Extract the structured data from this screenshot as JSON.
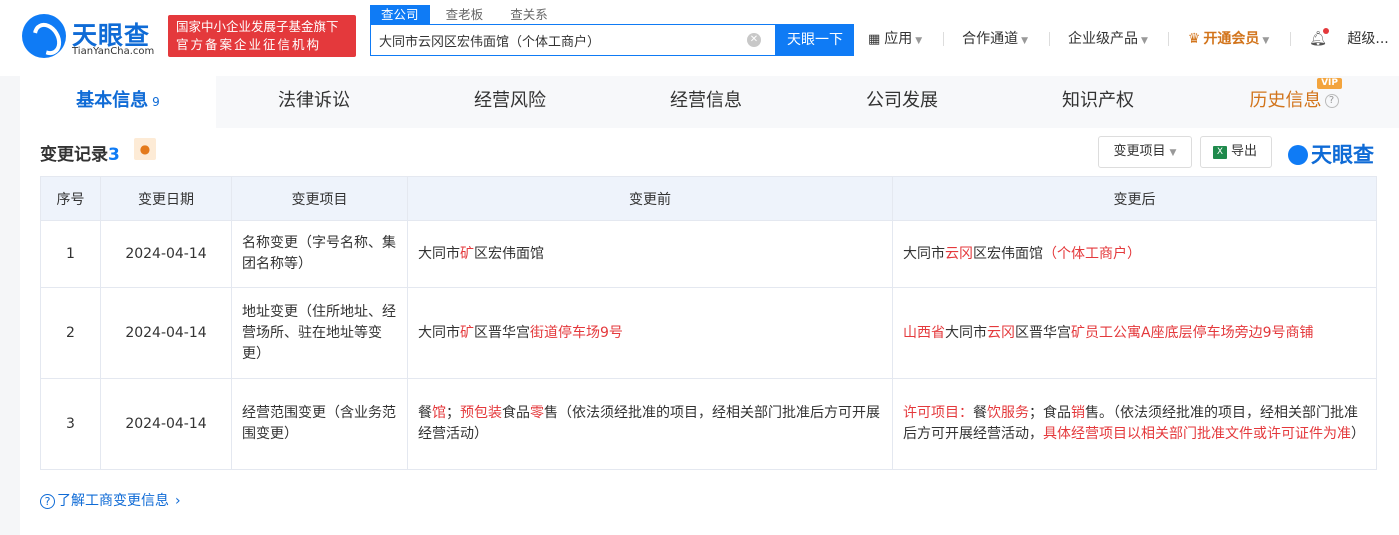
{
  "header": {
    "logo_cn": "天眼查",
    "logo_en": "TianYanCha.com",
    "badge_line1": "国家中小企业发展子基金旗下",
    "badge_line2": "官方备案企业征信机构",
    "search_tabs": [
      "查公司",
      "查老板",
      "查关系"
    ],
    "search_value": "大同市云冈区宏伟面馆（个体工商户）",
    "search_button": "天眼一下",
    "nav": {
      "apps": "应用",
      "channel": "合作通道",
      "enterprise": "企业级产品",
      "vip": "开通会员",
      "user": "超级..."
    }
  },
  "tabs": {
    "basic": "基本信息",
    "basic_count": "9",
    "legal": "法律诉讼",
    "risk": "经营风险",
    "operation": "经营信息",
    "development": "公司发展",
    "ip": "知识产权",
    "history": "历史信息",
    "vip_tag": "VIP"
  },
  "section": {
    "title": "变更记录",
    "count": "3",
    "filter_label": "变更项目",
    "export_label": "导出",
    "brand": "天眼查"
  },
  "table": {
    "headers": [
      "序号",
      "变更日期",
      "变更项目",
      "变更前",
      "变更后"
    ],
    "rows": [
      {
        "no": "1",
        "date": "2024-04-14",
        "item": "名称变更（字号名称、集团名称等）",
        "before": [
          [
            "大同市",
            ""
          ],
          [
            "矿",
            "hl"
          ],
          [
            "区宏伟面馆",
            ""
          ]
        ],
        "after": [
          [
            "大同市",
            ""
          ],
          [
            "云冈",
            "hl"
          ],
          [
            "区宏伟面馆",
            ""
          ],
          [
            "（个体工商户）",
            "hl"
          ]
        ]
      },
      {
        "no": "2",
        "date": "2024-04-14",
        "item": "地址变更（住所地址、经营场所、驻在地址等变更）",
        "before": [
          [
            "大同市",
            ""
          ],
          [
            "矿",
            "hl"
          ],
          [
            "区晋华宫",
            ""
          ],
          [
            "街道停车场9号",
            "hl"
          ]
        ],
        "after": [
          [
            "山西省",
            "hl"
          ],
          [
            "大同市",
            ""
          ],
          [
            "云冈",
            "hl"
          ],
          [
            "区晋华宫",
            ""
          ],
          [
            "矿员工公寓A座底层停车场旁边9号商铺",
            "hl"
          ]
        ]
      },
      {
        "no": "3",
        "date": "2024-04-14",
        "item": "经营范围变更（含业务范围变更）",
        "before": [
          [
            "餐",
            ""
          ],
          [
            "馆",
            "hl"
          ],
          [
            "；",
            ""
          ],
          [
            "预包装",
            "hl"
          ],
          [
            "食品",
            ""
          ],
          [
            "零",
            "hl"
          ],
          [
            "售（依法须经批准的项目，经相关部门批准后方可开展经营活动）",
            ""
          ]
        ],
        "after": [
          [
            "许可项目：",
            "hl"
          ],
          [
            "餐",
            ""
          ],
          [
            "饮服务",
            "hl"
          ],
          [
            "；食品",
            ""
          ],
          [
            "销",
            "hl"
          ],
          [
            "售。（依法须经批准的项目，经相关部门批准后方可开展经营活动，",
            ""
          ],
          [
            "具体经营项目以相关部门批准文件或许可证件为准",
            "hl"
          ],
          [
            "）",
            ""
          ]
        ]
      }
    ]
  },
  "learn_link": "了解工商变更信息"
}
